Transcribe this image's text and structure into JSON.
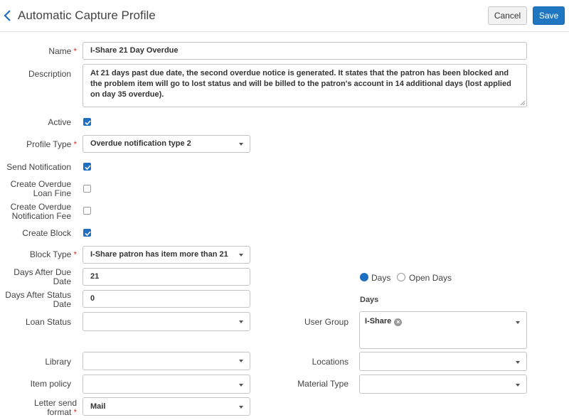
{
  "header": {
    "title": "Automatic Capture Profile",
    "cancel_label": "Cancel",
    "save_label": "Save"
  },
  "form": {
    "name": {
      "label": "Name",
      "value": "I-Share 21 Day Overdue"
    },
    "description": {
      "label": "Description",
      "value": "At 21 days past due date, the second overdue notice is generated. It states that the patron has been blocked and the problem item will go to lost status and will be billed to the patron's account in 14 additional days (lost applied on day 35 overdue)."
    },
    "active": {
      "label": "Active",
      "checked": true
    },
    "profile_type": {
      "label": "Profile Type",
      "value": "Overdue notification type 2"
    },
    "send_notification": {
      "label": "Send Notification",
      "checked": true
    },
    "create_overdue_loan_fine": {
      "label_line1": "Create Overdue",
      "label_line2": "Loan Fine",
      "checked": false
    },
    "create_overdue_notification_fee": {
      "label_line1": "Create Overdue",
      "label_line2": "Notification Fee",
      "checked": false
    },
    "create_block": {
      "label": "Create Block",
      "checked": true
    },
    "block_type": {
      "label": "Block Type",
      "value": "I-Share patron has item more than 21"
    },
    "days_after_due_date": {
      "label_line1": "Days After Due",
      "label_line2": "Date",
      "value": "21"
    },
    "days_after_status_date": {
      "label_line1": "Days After Status",
      "label_line2": "Date",
      "value": "0"
    },
    "day_mode": {
      "option_days": "Days",
      "option_open_days": "Open Days",
      "selected": "Days"
    },
    "days_heading": "Days",
    "loan_status": {
      "label": "Loan Status",
      "value": ""
    },
    "user_group": {
      "label": "User Group",
      "chip": "I-Share"
    },
    "library": {
      "label": "Library",
      "value": ""
    },
    "locations": {
      "label": "Locations",
      "value": ""
    },
    "item_policy": {
      "label": "Item policy",
      "value": ""
    },
    "material_type": {
      "label": "Material Type",
      "value": ""
    },
    "letter_send_format": {
      "label_line1": "Letter send",
      "label_line2": "format",
      "value": "Mail"
    }
  },
  "colors": {
    "accent": "#1f6fc0",
    "required": "#d9372e"
  }
}
